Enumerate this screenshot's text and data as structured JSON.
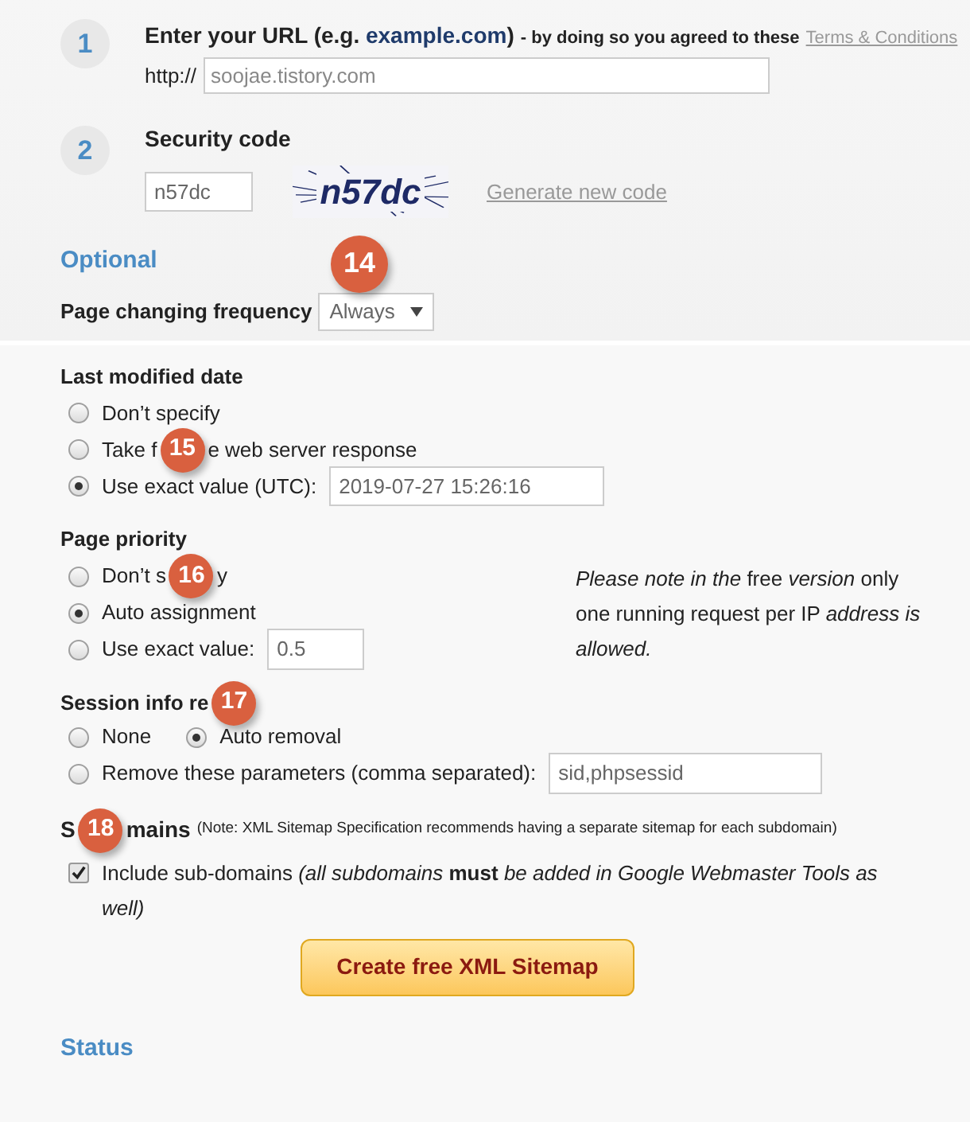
{
  "steps": [
    {
      "number": "1",
      "title_main": "Enter your URL (e.g. ",
      "title_example": "example.com",
      "title_dash": ")",
      "title_note": "- by doing so you agreed to these",
      "terms_link": "Terms & Conditions",
      "prefix": "http://",
      "placeholder": "soojae.tistory.com"
    },
    {
      "number": "2",
      "title_main": "Security code",
      "code_value": "n57dc",
      "captcha_text": "n57dc",
      "generate_link": "Generate new code"
    }
  ],
  "optional_heading": "Optional",
  "frequency": {
    "label": "Page changing frequency",
    "value": "Always",
    "badge": "14"
  },
  "last_modified": {
    "heading": "Last modified date",
    "options": [
      {
        "label": "Don’t specify",
        "selected": false
      },
      {
        "label": "Take f",
        "label_after": "e web server response",
        "badge": "15",
        "selected": false
      },
      {
        "label": "Use exact value (UTC):",
        "field": "2019-07-27 15:26:16",
        "selected": true
      }
    ]
  },
  "priority": {
    "heading": "Page priority",
    "options": [
      {
        "label": "Don’t s",
        "label_after": "y",
        "badge": "16",
        "selected": false
      },
      {
        "label": "Auto assignment",
        "selected": true
      },
      {
        "label": "Use exact value:",
        "field": "0.5",
        "selected": false
      }
    ]
  },
  "note": "*Please note in the* free *version* only one running request per IP *address is allowed.*",
  "session": {
    "heading": "Session info re",
    "badge": "17",
    "options": [
      {
        "label": "None",
        "selected": false
      },
      {
        "label": "Auto removal",
        "selected": true
      },
      {
        "label": "Remove these parameters (comma separated):",
        "field": "sid,phpsessid",
        "selected": false
      }
    ]
  },
  "subdomains": {
    "heading": "S",
    "heading_after": "mains",
    "badge": "18",
    "note": "(Note: XML Sitemap Specification recommends having a separate sitemap for each subdomain)",
    "checkbox_label": "Include sub-domains *(all subdomains* **must** *be added in Google Webmaster Tools as well)*",
    "checked": true
  },
  "create_button": "Create free XML Sitemap",
  "status_heading": "Status"
}
